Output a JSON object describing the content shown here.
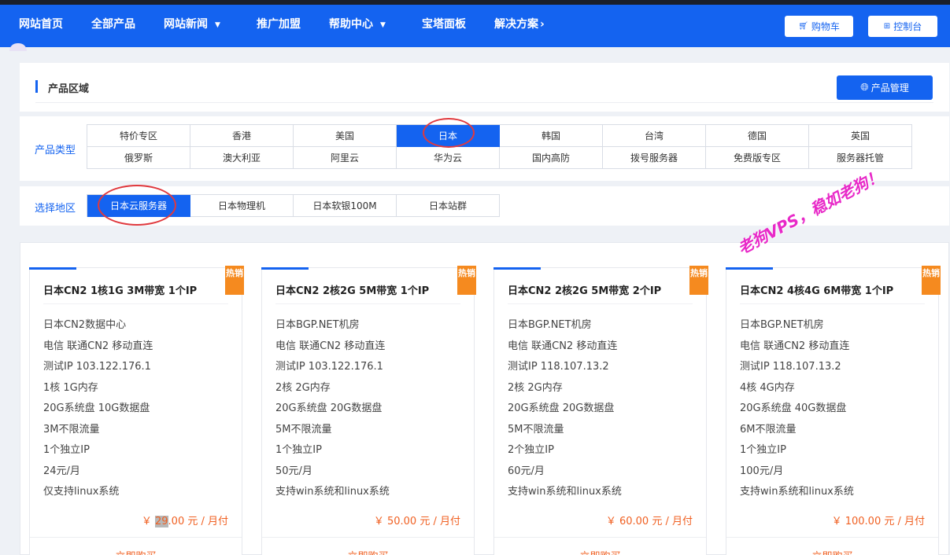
{
  "nav": {
    "items": [
      {
        "label": "网站首页",
        "caret": false
      },
      {
        "label": "全部产品",
        "caret": false
      },
      {
        "label": "网站新闻",
        "caret": true
      },
      {
        "label": "推广加盟",
        "caret": false
      },
      {
        "label": "帮助中心",
        "caret": true
      },
      {
        "label": "宝塔面板",
        "caret": false
      },
      {
        "label": "解决方案",
        "chevron": "›"
      }
    ],
    "cart_label": "购物车",
    "console_label": "控制台"
  },
  "region_panel": {
    "title": "产品区域",
    "manage_label": "产品管理"
  },
  "product_type": {
    "label": "产品类型",
    "rows": [
      [
        "特价专区",
        "香港",
        "美国",
        "日本",
        "韩国",
        "台湾",
        "德国",
        "英国"
      ],
      [
        "俄罗斯",
        "澳大利亚",
        "阿里云",
        "华为云",
        "国内高防",
        "拨号服务器",
        "免费版专区",
        "服务器托管"
      ]
    ],
    "selected": "日本"
  },
  "area": {
    "label": "选择地区",
    "options": [
      "日本云服务器",
      "日本物理机",
      "日本软银100M",
      "日本站群"
    ],
    "selected": "日本云服务器"
  },
  "badge_text": "热销",
  "buy_label": "立即购买",
  "watermark": "老狗VPS，稳如老狗！",
  "products": [
    {
      "name": "日本CN2 1核1G 3M带宽 1个IP",
      "specs": [
        "日本CN2数据中心",
        "电信 联通CN2 移动直连",
        "测试IP 103.122.176.1",
        "1核 1G内存",
        "20G系统盘 10G数据盘",
        "3M不限流量",
        "1个独立IP",
        "24元/月",
        "仅支持linux系统"
      ],
      "price_prefix": "￥",
      "price_highlight": "29",
      "price_suffix": ".00 元 / 月付"
    },
    {
      "name": "日本CN2 2核2G 5M带宽 1个IP",
      "specs": [
        "日本BGP.NET机房",
        "电信 联通CN2 移动直连",
        "测试IP 103.122.176.1",
        "2核 2G内存",
        "20G系统盘 20G数据盘",
        "5M不限流量",
        "1个独立IP",
        "50元/月",
        "支持win系统和linux系统"
      ],
      "price": "￥ 50.00 元 / 月付"
    },
    {
      "name": "日本CN2 2核2G 5M带宽 2个IP",
      "specs": [
        "日本BGP.NET机房",
        "电信 联通CN2 移动直连",
        "测试IP 118.107.13.2",
        "2核 2G内存",
        "20G系统盘 20G数据盘",
        "5M不限流量",
        "2个独立IP",
        "60元/月",
        "支持win系统和linux系统"
      ],
      "price": "￥ 60.00 元 / 月付"
    },
    {
      "name": "日本CN2 4核4G 6M带宽 1个IP",
      "specs": [
        "日本BGP.NET机房",
        "电信 联通CN2 移动直连",
        "测试IP 118.107.13.2",
        "4核 4G内存",
        "20G系统盘 40G数据盘",
        "6M不限流量",
        "1个独立IP",
        "100元/月",
        "支持win系统和linux系统"
      ],
      "price": "￥ 100.00 元 / 月付"
    }
  ],
  "colors": {
    "primary": "#1463f0",
    "price": "#f06022",
    "hot_badge": "#f58a1f",
    "annotation_ring": "#e0393e",
    "watermark": "#e829c8"
  }
}
